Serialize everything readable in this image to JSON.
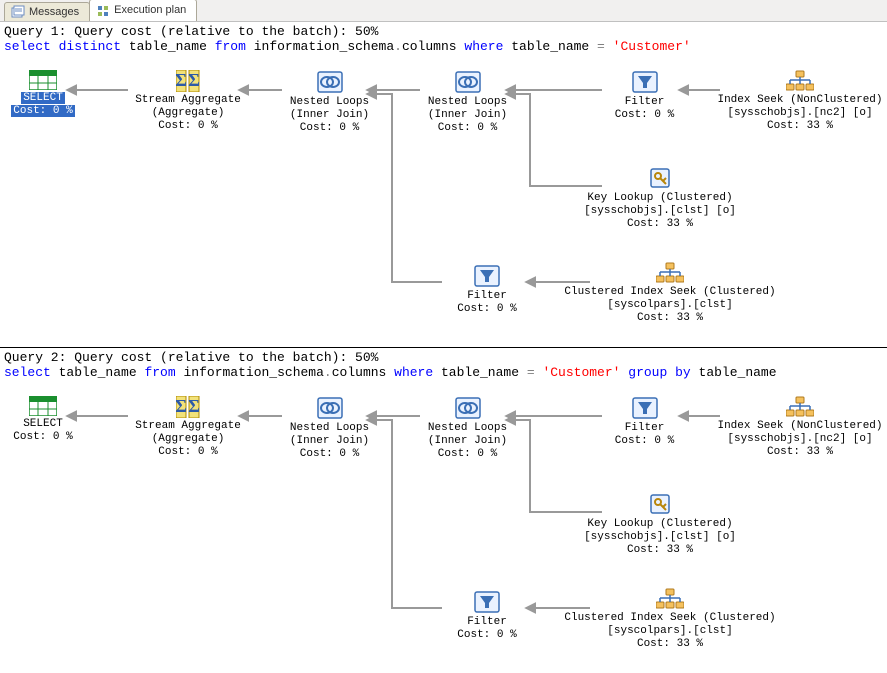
{
  "tabs": {
    "messages": "Messages",
    "plan": "Execution plan"
  },
  "query1": {
    "header": "Query 1: Query cost (relative to the batch): 50%",
    "sql_parts": {
      "select": "select",
      "distinct": "distinct",
      "col": "table_name",
      "from": "from",
      "schema": "information_schema",
      "dot": ".",
      "tbl": "columns",
      "where": "where",
      "col2": "table_name",
      "eq": "=",
      "lit": "'Customer'"
    },
    "nodes": {
      "select": {
        "title": "SELECT",
        "cost": "Cost: 0 %"
      },
      "agg": {
        "title": "Stream Aggregate",
        "sub": "(Aggregate)",
        "cost": "Cost: 0 %"
      },
      "nl1": {
        "title": "Nested Loops",
        "sub": "(Inner Join)",
        "cost": "Cost: 0 %"
      },
      "nl2": {
        "title": "Nested Loops",
        "sub": "(Inner Join)",
        "cost": "Cost: 0 %"
      },
      "filter1": {
        "title": "Filter",
        "cost": "Cost: 0 %"
      },
      "ixseek": {
        "title": "Index Seek (NonClustered)",
        "sub": "[sysschobjs].[nc2] [o]",
        "cost": "Cost: 33 %"
      },
      "keylookup": {
        "title": "Key Lookup (Clustered)",
        "sub": "[sysschobjs].[clst] [o]",
        "cost": "Cost: 33 %"
      },
      "filter2": {
        "title": "Filter",
        "cost": "Cost: 0 %"
      },
      "cixseek": {
        "title": "Clustered Index Seek (Clustered)",
        "sub": "[syscolpars].[clst]",
        "cost": "Cost: 33 %"
      }
    }
  },
  "query2": {
    "header": "Query 2: Query cost (relative to the batch): 50%",
    "sql_parts": {
      "select": "select",
      "col": "table_name",
      "from": "from",
      "schema": "information_schema",
      "dot": ".",
      "tbl": "columns",
      "where": "where",
      "col2": "table_name",
      "eq": "=",
      "lit": "'Customer'",
      "group": "group",
      "by": "by",
      "col3": "table_name"
    },
    "nodes": {
      "select": {
        "title": "SELECT",
        "cost": "Cost: 0 %"
      },
      "agg": {
        "title": "Stream Aggregate",
        "sub": "(Aggregate)",
        "cost": "Cost: 0 %"
      },
      "nl1": {
        "title": "Nested Loops",
        "sub": "(Inner Join)",
        "cost": "Cost: 0 %"
      },
      "nl2": {
        "title": "Nested Loops",
        "sub": "(Inner Join)",
        "cost": "Cost: 0 %"
      },
      "filter1": {
        "title": "Filter",
        "cost": "Cost: 0 %"
      },
      "ixseek": {
        "title": "Index Seek (NonClustered)",
        "sub": "[sysschobjs].[nc2] [o]",
        "cost": "Cost: 33 %"
      },
      "keylookup": {
        "title": "Key Lookup (Clustered)",
        "sub": "[sysschobjs].[clst] [o]",
        "cost": "Cost: 33 %"
      },
      "filter2": {
        "title": "Filter",
        "cost": "Cost: 0 %"
      },
      "cixseek": {
        "title": "Clustered Index Seek (Clustered)",
        "sub": "[syscolpars].[clst]",
        "cost": "Cost: 33 %"
      }
    }
  }
}
